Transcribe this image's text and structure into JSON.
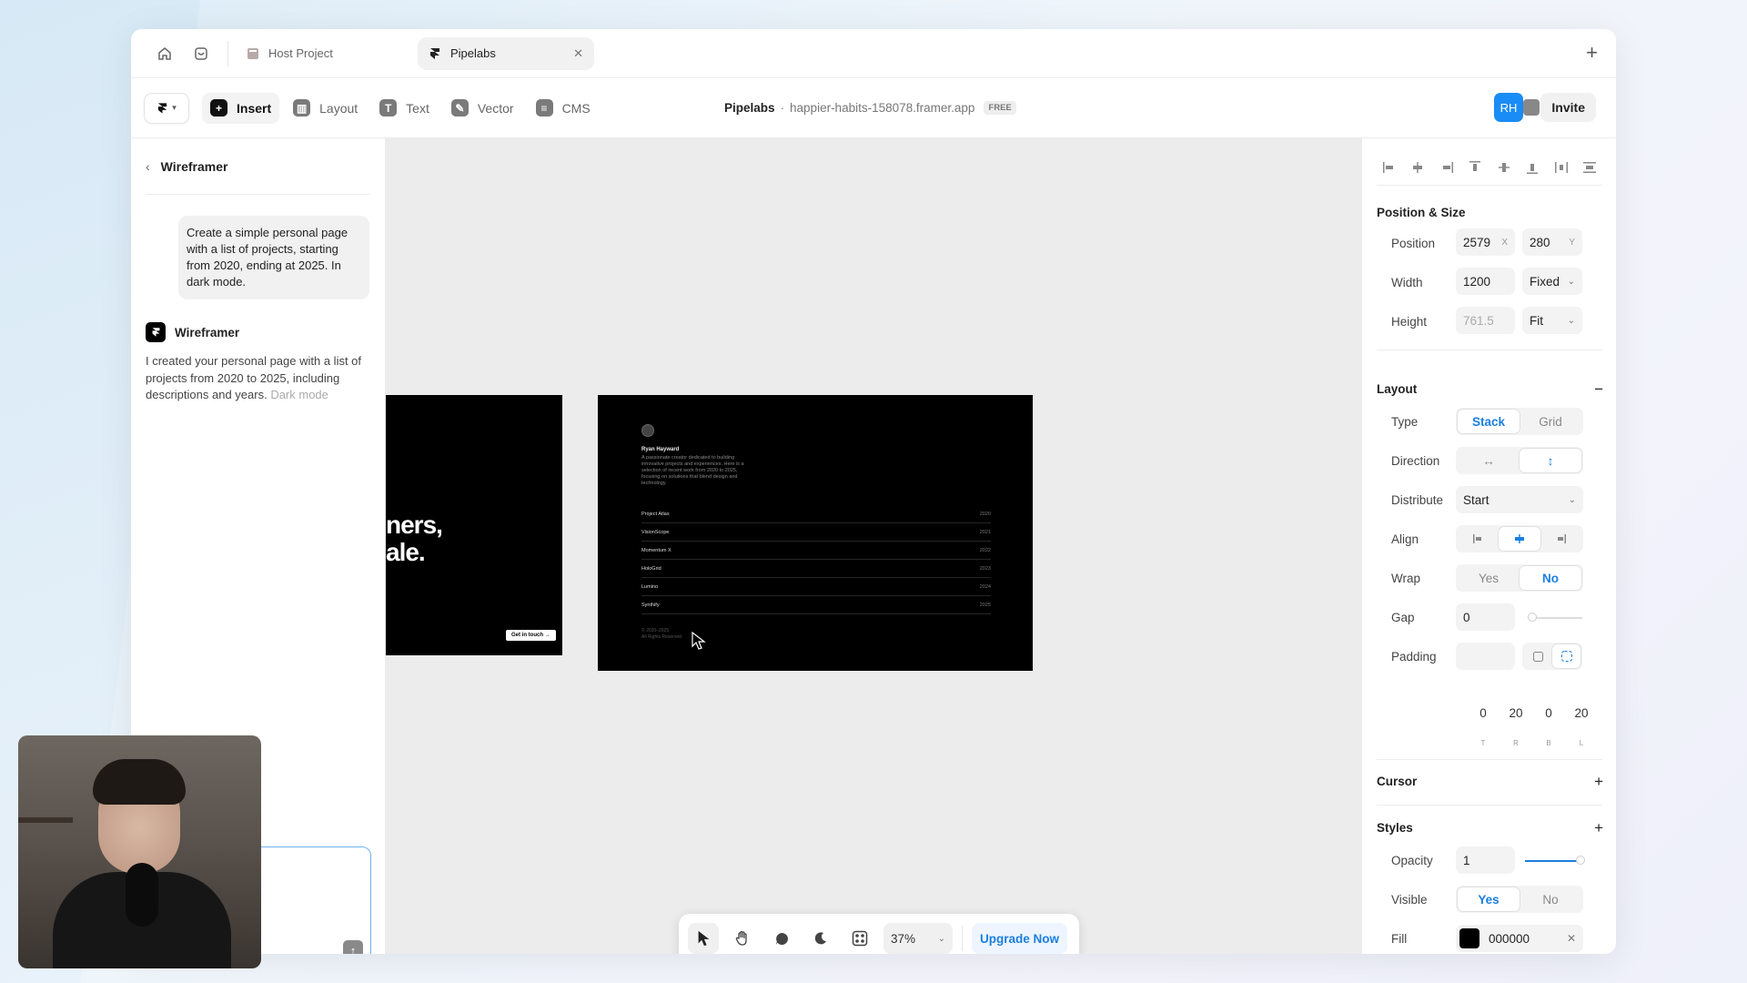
{
  "tabs": [
    {
      "label": "Host Project",
      "active": false
    },
    {
      "label": "Pipelabs",
      "active": true
    }
  ],
  "toolbar": {
    "tools": [
      {
        "label": "Insert",
        "icon": "plus-icon",
        "active": true
      },
      {
        "label": "Layout",
        "icon": "layout-icon",
        "active": false
      },
      {
        "label": "Text",
        "icon": "text-icon",
        "active": false
      },
      {
        "label": "Vector",
        "icon": "pen-icon",
        "active": false
      },
      {
        "label": "CMS",
        "icon": "database-icon",
        "active": false
      }
    ],
    "project_name": "Pipelabs",
    "project_sep": "·",
    "project_url": "happier-habits-158078.framer.app",
    "plan_badge": "FREE",
    "avatar_initials": "RH",
    "invite_label": "Invite"
  },
  "left_panel": {
    "title": "Wireframer",
    "user_message": "Create a simple personal page with a list of projects, starting from 2020, ending at 2025. In dark mode.",
    "bot_name": "Wireframer",
    "bot_message": "I created your personal page with a list of projects from 2020 to 2025, including descriptions and years.",
    "bot_message_fading": "Dark mode"
  },
  "canvas": {
    "frame1_heading": [
      "ners,",
      "ale."
    ],
    "frame1_button": "Get in touch →",
    "frame2": {
      "name": "Ryan Hayward",
      "bio": "A passionate creator dedicated to building innovative projects and experiences. Here is a selection of recent work from 2020 to 2025, focusing on solutions that blend design and technology.",
      "projects": [
        {
          "name": "Project Atlas",
          "year": "2020"
        },
        {
          "name": "VisionScope",
          "year": "2021"
        },
        {
          "name": "Momentum X",
          "year": "2022"
        },
        {
          "name": "HoloGrid",
          "year": "2023"
        },
        {
          "name": "Lumino",
          "year": "2024"
        },
        {
          "name": "Synthify",
          "year": "2025"
        }
      ],
      "footer": [
        "© 2020–2025",
        "All Rights Reserved"
      ]
    }
  },
  "bottom_bar": {
    "zoom": "37%",
    "upgrade_label": "Upgrade Now"
  },
  "right_panel": {
    "position_size": {
      "title": "Position & Size",
      "position_label": "Position",
      "x": "2579",
      "x_suffix": "X",
      "y": "280",
      "y_suffix": "Y",
      "width_label": "Width",
      "width": "1200",
      "width_mode": "Fixed",
      "height_label": "Height",
      "height": "761.5",
      "height_mode": "Fit"
    },
    "layout": {
      "title": "Layout",
      "type_label": "Type",
      "type_options": [
        "Stack",
        "Grid"
      ],
      "direction_label": "Direction",
      "distribute_label": "Distribute",
      "distribute": "Start",
      "align_label": "Align",
      "wrap_label": "Wrap",
      "wrap_options": [
        "Yes",
        "No"
      ],
      "gap_label": "Gap",
      "gap": "0",
      "padding_label": "Padding",
      "padding_values": [
        "0",
        "20",
        "0",
        "20"
      ],
      "padding_sides": [
        "T",
        "R",
        "B",
        "L"
      ]
    },
    "cursor_title": "Cursor",
    "styles": {
      "title": "Styles",
      "opacity_label": "Opacity",
      "opacity": "1",
      "visible_label": "Visible",
      "visible_options": [
        "Yes",
        "No"
      ],
      "fill_label": "Fill",
      "fill": "000000"
    }
  },
  "colors": {
    "accent": "#1a8cf5",
    "canvas_bg": "#ececec"
  }
}
